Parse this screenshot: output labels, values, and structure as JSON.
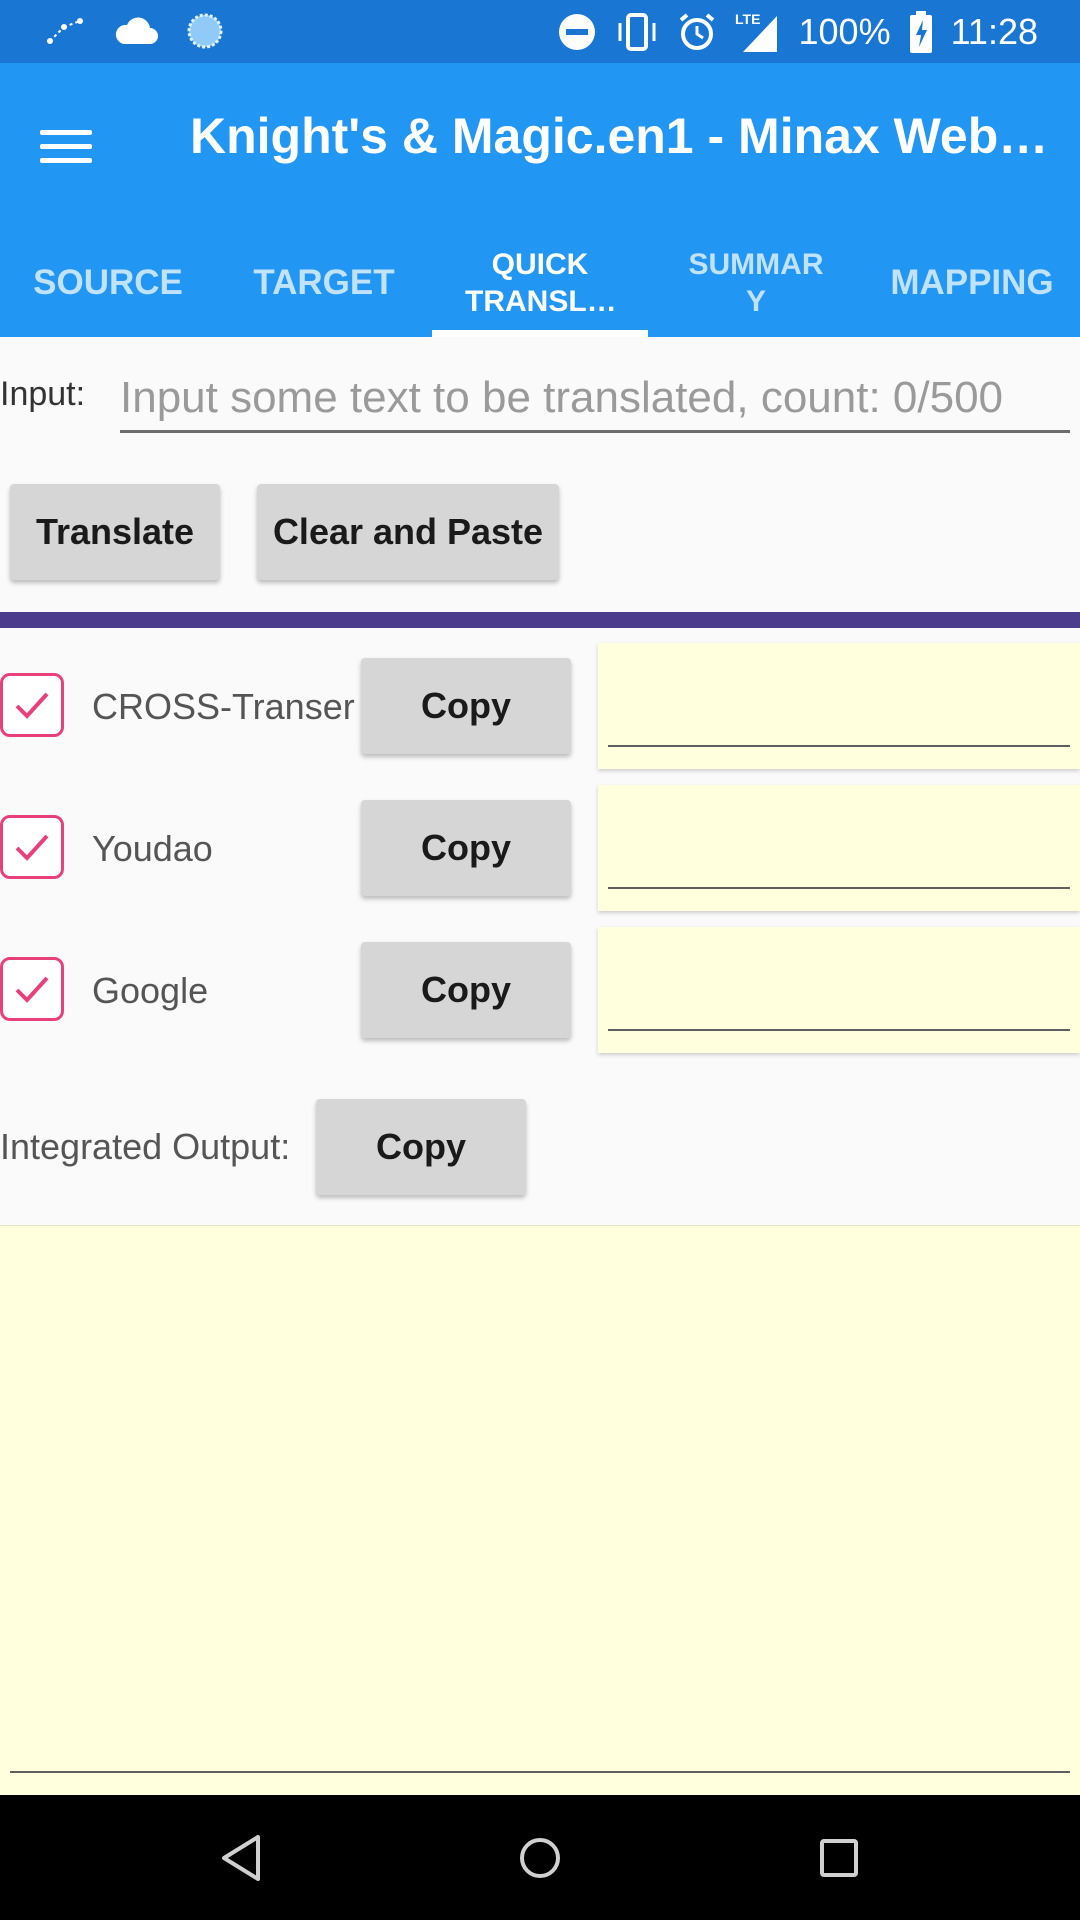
{
  "status_bar": {
    "battery": "100%",
    "time": "11:28",
    "network": "LTE",
    "icons": [
      "constellation-icon",
      "cloud-icon",
      "sync-icon",
      "dnd-icon",
      "vibrate-icon",
      "alarm-icon",
      "signal-icon",
      "battery-charging-icon"
    ]
  },
  "app_bar": {
    "title": "Knight's & Magic.en1 - Minax Web…",
    "menu_icon": "hamburger-menu-icon"
  },
  "tabs": [
    {
      "label": "SOURCE"
    },
    {
      "label": "TARGET"
    },
    {
      "label": "QUICK TRANSL…"
    },
    {
      "label": "SUMMAR Y"
    },
    {
      "label": "MAPPING"
    }
  ],
  "input": {
    "label": "Input:",
    "placeholder": "Input some text to be translated, count: 0/500",
    "value": ""
  },
  "buttons": {
    "translate": "Translate",
    "clear_paste": "Clear and Paste"
  },
  "engines": [
    {
      "name": "CROSS-Transer",
      "checked": true,
      "copy_label": "Copy",
      "output": ""
    },
    {
      "name": "Youdao",
      "checked": true,
      "copy_label": "Copy",
      "output": ""
    },
    {
      "name": "Google",
      "checked": true,
      "copy_label": "Copy",
      "output": ""
    }
  ],
  "integrated": {
    "label": "Integrated Output:",
    "copy_label": "Copy",
    "output": ""
  },
  "colors": {
    "status_bar": "#1976d2",
    "app_bar": "#2196f3",
    "divider": "#4b3c8e",
    "checkbox": "#e8407a",
    "output_bg": "#ffffde"
  }
}
